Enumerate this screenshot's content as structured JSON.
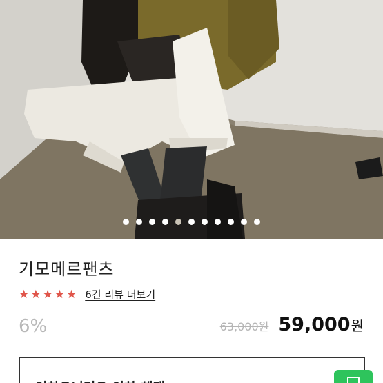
{
  "gallery": {
    "image_alt": "",
    "slide_count": 11,
    "active_index": 4
  },
  "product": {
    "name": "기모메르팬츠",
    "rating": {
      "stars": 5,
      "star_glyph": "★",
      "review_link": "6건 리뷰 더보기"
    },
    "discount": "6%",
    "original_price": "63,000원",
    "price": "59,000",
    "currency": "원"
  },
  "coupon": {
    "text": "이하오니미오 이하 해태"
  },
  "colors": {
    "star": "#e0554a",
    "discount": "#b8b8b8",
    "fab": "#2ec45c"
  },
  "icons": {
    "fab": "chat-icon"
  }
}
